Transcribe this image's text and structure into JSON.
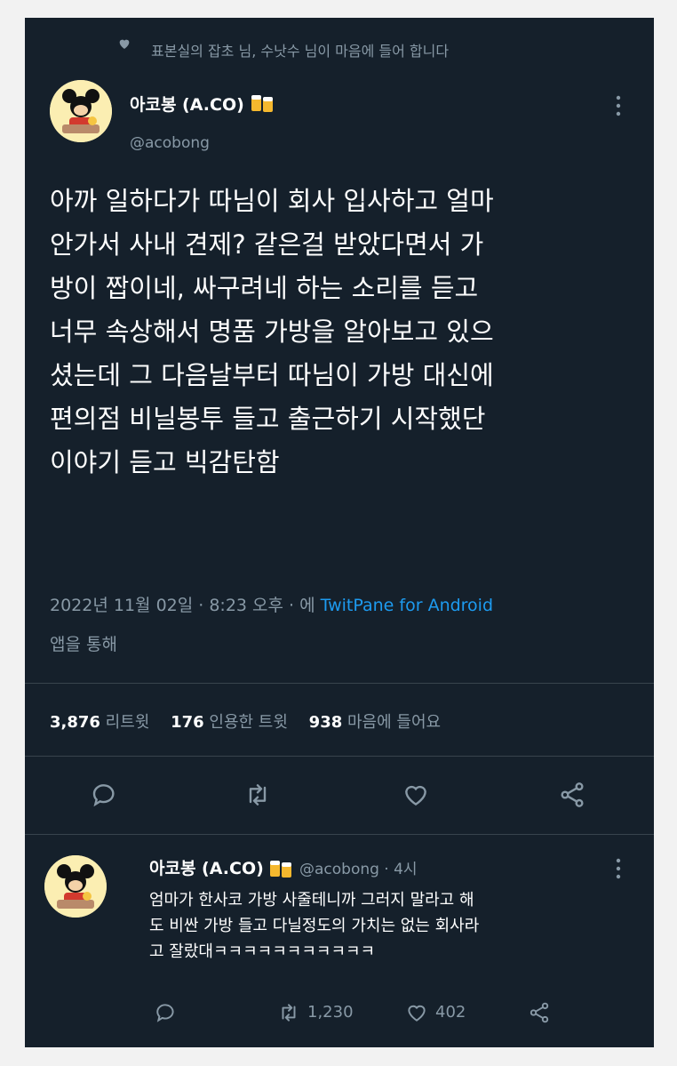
{
  "context": {
    "liked_text": "표본실의 잡초 님, 수낫수 님이 마음에 들어 합니다"
  },
  "tweet": {
    "display_name": "아코봉 (A.CO)",
    "handle": "@acobong",
    "body_lines": [
      "아까 일하다가 따님이 회사 입사하고 얼마",
      "안가서 사내 견제? 같은걸 받았다면서 가",
      "방이 짭이네, 싸구려네 하는 소리를 듣고",
      "너무 속상해서 명품 가방을 알아보고 있으",
      "셨는데 그 다음날부터 따님이 가방 대신에",
      "편의점 비닐봉투 들고 출근하기 시작했단",
      "이야기 듣고 빅감탄함"
    ],
    "date": "2022년 11월 02일 · 8:23 오후 · 에 ",
    "source_link": "TwitPane for Android",
    "source_suffix": "앱을 통해",
    "stats": {
      "retweets_count": "3,876",
      "retweets_label": "리트윗",
      "quotes_count": "176",
      "quotes_label": "인용한 트윗",
      "likes_count": "938",
      "likes_label": "마음에 들어요"
    }
  },
  "reply": {
    "display_name": "아코봉 (A.CO)",
    "handle_time": "@acobong · 4시",
    "body_lines": [
      "엄마가 한사코 가방 사줄테니까 그러지 말라고 해",
      "도 비싼 가방 들고 다닐정도의 가치는 없는 회사라",
      "고 잘랐대ㅋㅋㅋㅋㅋㅋㅋㅋㅋㅋㅋ"
    ],
    "retweet_count": "1,230",
    "like_count": "402"
  },
  "colors": {
    "background": "#15202b",
    "secondary_text": "#8899a6",
    "link": "#1d9bf0"
  },
  "icons": [
    "heart-icon",
    "more-icon",
    "beer-icon",
    "reply-icon",
    "retweet-icon",
    "like-icon",
    "share-icon"
  ]
}
